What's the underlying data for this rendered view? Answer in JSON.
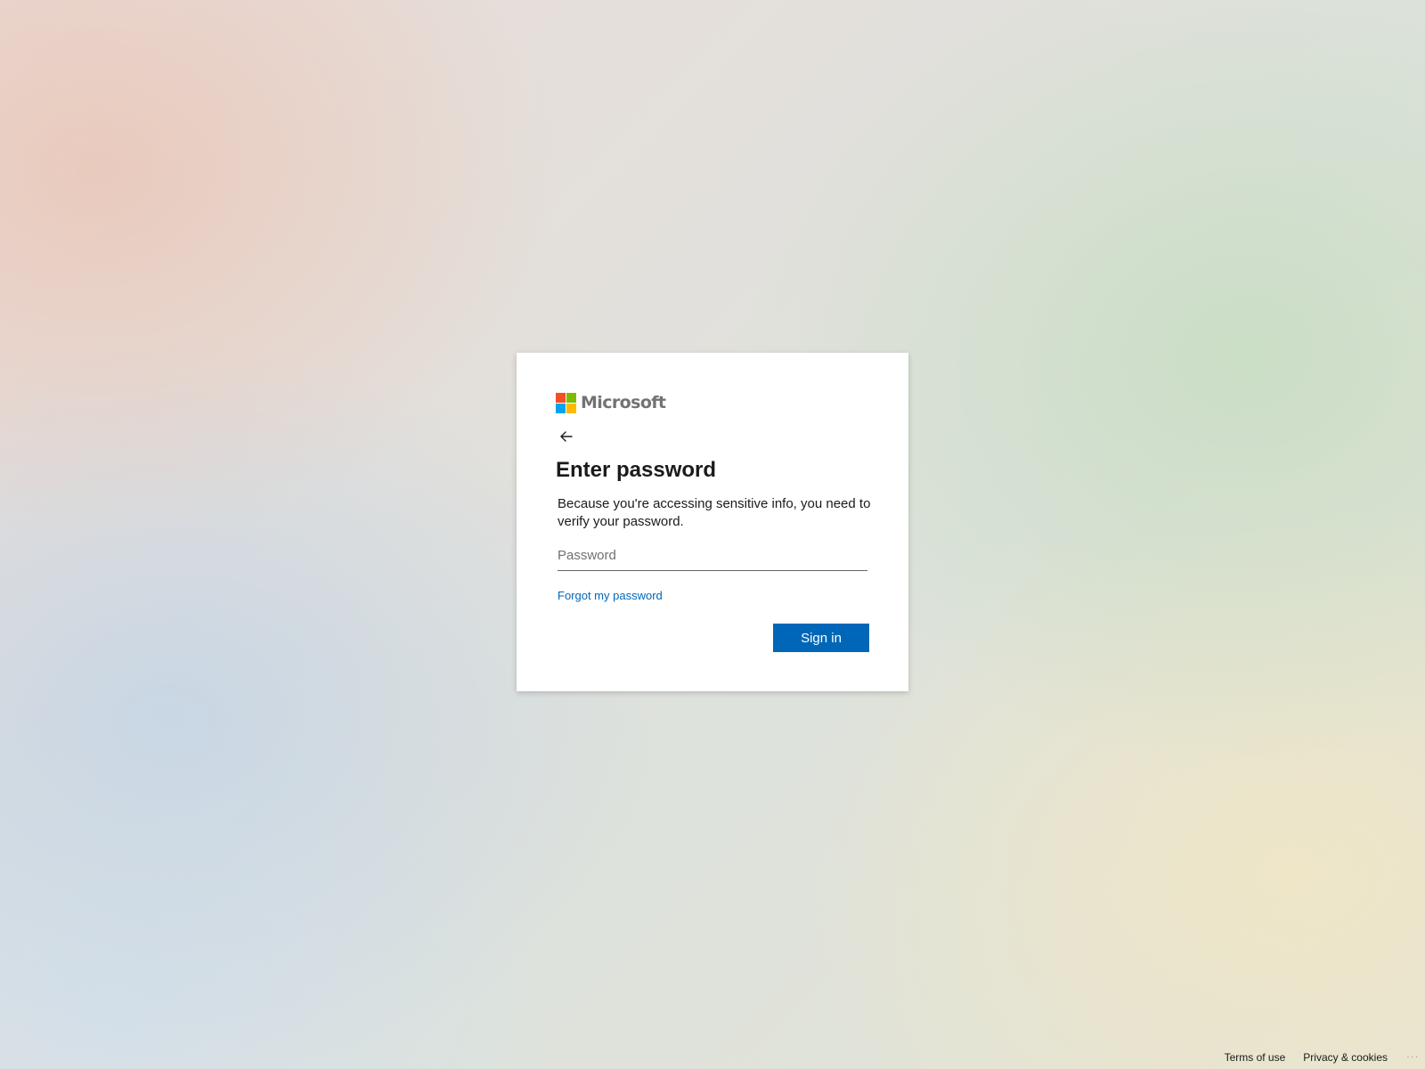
{
  "brand": {
    "name": "Microsoft",
    "colors": [
      "#f25022",
      "#7fba00",
      "#00a4ef",
      "#ffb900"
    ]
  },
  "card": {
    "back_icon": "arrow-left-icon",
    "title": "Enter password",
    "description": "Because you're accessing sensitive info, you need to verify your password.",
    "password": {
      "placeholder": "Password",
      "value": ""
    },
    "forgot_link": "Forgot my password",
    "signin_label": "Sign in",
    "accent_color": "#0067b8"
  },
  "footer": {
    "terms": "Terms of use",
    "privacy": "Privacy & cookies",
    "more": "..."
  }
}
